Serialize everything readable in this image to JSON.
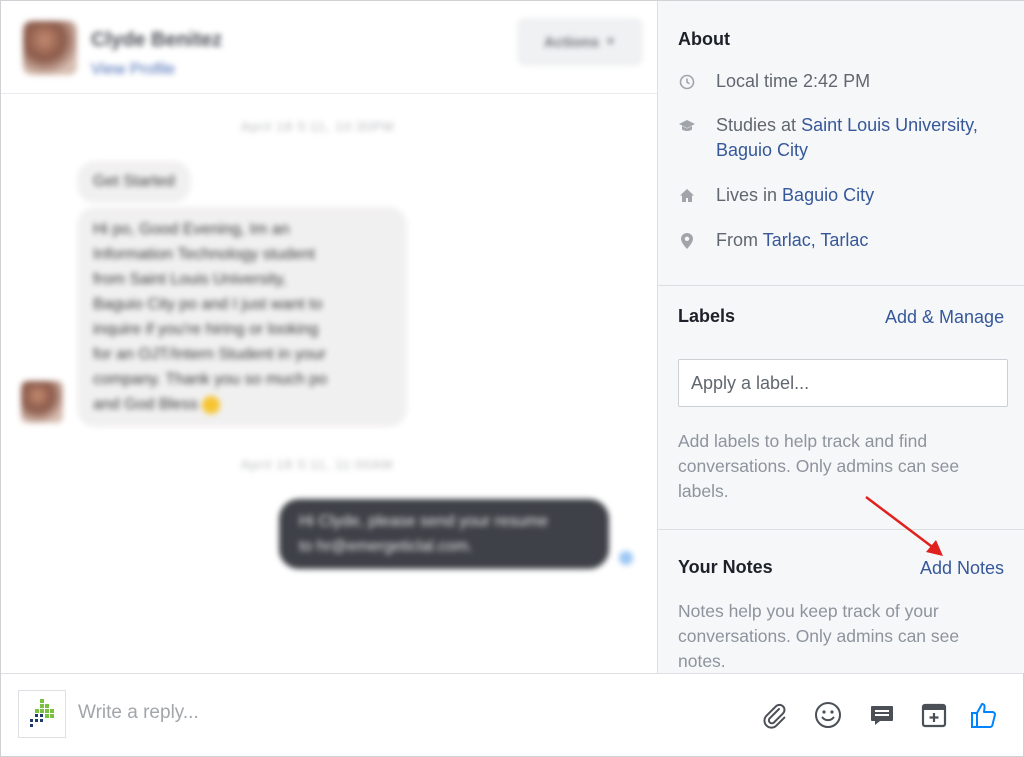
{
  "header": {
    "contact_name": "Clyde Benitez",
    "profile_link": "View Profile",
    "actions_label": "Actions"
  },
  "chat": {
    "timestamp1": "April 18 5:11, 10:30PM",
    "timestamp2": "April 18 5:11, 11:00AM",
    "msg1": "Get Started",
    "msg2_lines": [
      "Hi po, Good Evening, Im an",
      "Information Technology student",
      "from Saint Louis University,",
      "Baguio City po and I just want to",
      "inquire if you're hiring or looking",
      "for an OJT/Intern Student in your",
      "company. Thank you so much po",
      "and God Bless"
    ],
    "msg3_lines": [
      "Hi Clyde, please send your resume",
      "to hr@emergeticlal.com."
    ]
  },
  "about": {
    "title": "About",
    "local_time": "Local time 2:42 PM",
    "studies_prefix": "Studies at",
    "studies_link_line1": "Saint Louis University,",
    "studies_link_line2": "Baguio City",
    "lives_prefix": "Lives in",
    "lives_link": "Baguio City",
    "from_prefix": "From",
    "from_link": "Tarlac, Tarlac"
  },
  "labels": {
    "title": "Labels",
    "manage_link": "Add & Manage",
    "input_placeholder": "Apply a label...",
    "help_lines": [
      "Add labels to help track and find",
      "conversations. Only admins can see",
      "labels."
    ]
  },
  "notes": {
    "title": "Your Notes",
    "add_link": "Add Notes",
    "help_lines": [
      "Notes help you keep track of your",
      "conversations. Only admins can see",
      "notes."
    ]
  },
  "composer": {
    "placeholder": "Write a reply..."
  },
  "icons": {
    "clock": "clock-icon",
    "education": "graduation-cap-icon",
    "home": "home-icon",
    "location": "map-pin-icon",
    "attach": "paperclip-icon",
    "emoji": "smiley-icon",
    "saved_reply": "chat-bubble-icon",
    "appointment": "calendar-plus-icon",
    "like": "thumbs-up-icon"
  },
  "colors": {
    "link": "#365899",
    "like": "#0084ff",
    "arrow": "#e0211d"
  }
}
